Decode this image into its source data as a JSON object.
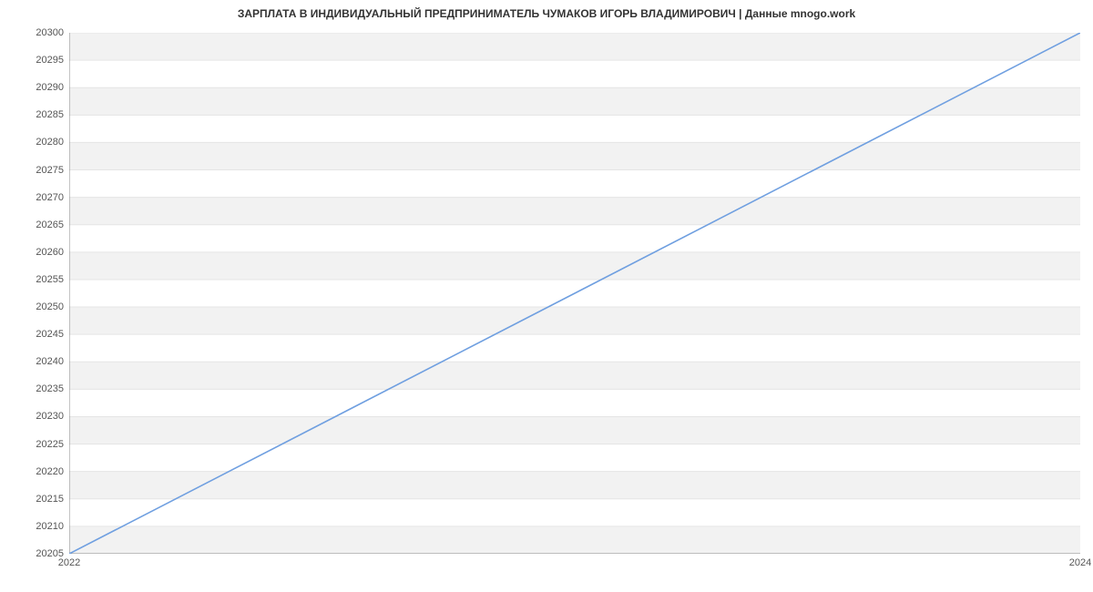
{
  "chart_data": {
    "type": "line",
    "title": "ЗАРПЛАТА В ИНДИВИДУАЛЬНЫЙ ПРЕДПРИНИМАТЕЛЬ ЧУМАКОВ ИГОРЬ ВЛАДИМИРОВИЧ | Данные mnogo.work",
    "x": [
      2022,
      2024
    ],
    "values": [
      20205,
      20300
    ],
    "x_ticks": [
      2022,
      2024
    ],
    "y_ticks": [
      20205,
      20210,
      20215,
      20220,
      20225,
      20230,
      20235,
      20240,
      20245,
      20250,
      20255,
      20260,
      20265,
      20270,
      20275,
      20280,
      20285,
      20290,
      20295,
      20300
    ],
    "xlim": [
      2022,
      2024
    ],
    "ylim": [
      20205,
      20300
    ],
    "xlabel": "",
    "ylabel": "",
    "line_color": "#6f9fe0",
    "grid_band_color": "#f2f2f2"
  }
}
